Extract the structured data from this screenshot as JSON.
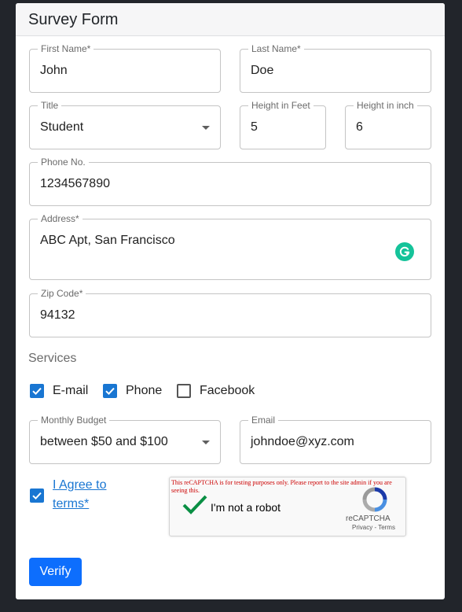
{
  "form": {
    "title": "Survey Form",
    "first_name": {
      "label": "First Name*",
      "value": "John"
    },
    "last_name": {
      "label": "Last Name*",
      "value": "Doe"
    },
    "title_select": {
      "label": "Title",
      "value": "Student"
    },
    "height_feet": {
      "label": "Height in Feet",
      "value": "5"
    },
    "height_inch": {
      "label": "Height in inch",
      "value": "6"
    },
    "phone": {
      "label": "Phone No.",
      "value": "1234567890"
    },
    "address": {
      "label": "Address*",
      "value": "ABC Apt, San Francisco"
    },
    "zip": {
      "label": "Zip Code*",
      "value": "94132"
    },
    "services": {
      "title": "Services",
      "options": [
        {
          "label": "E-mail",
          "checked": true
        },
        {
          "label": "Phone",
          "checked": true
        },
        {
          "label": "Facebook",
          "checked": false
        }
      ]
    },
    "budget": {
      "label": "Monthly Budget",
      "value": "between $50 and $100"
    },
    "email": {
      "label": "Email",
      "value": "johndoe@xyz.com"
    },
    "agree": {
      "label": "I Agree to terms*",
      "checked": true
    },
    "captcha": {
      "warning": "This reCAPTCHA is for testing purposes only. Please report to the site admin if you are seeing this.",
      "label": "I'm not a robot",
      "brand": "reCAPTCHA",
      "links": "Privacy - Terms",
      "checked": true
    },
    "verify_label": "Verify"
  },
  "colors": {
    "accent": "#1976d2",
    "button": "#0d6efd",
    "background": "#22252b",
    "grammarly": "#15c39a",
    "captcha_check": "#0a8f44"
  },
  "icons": [
    "grammarly-icon",
    "dropdown-caret-icon",
    "checkbox-check-icon",
    "recaptcha-logo-icon",
    "captcha-checkmark-icon"
  ]
}
